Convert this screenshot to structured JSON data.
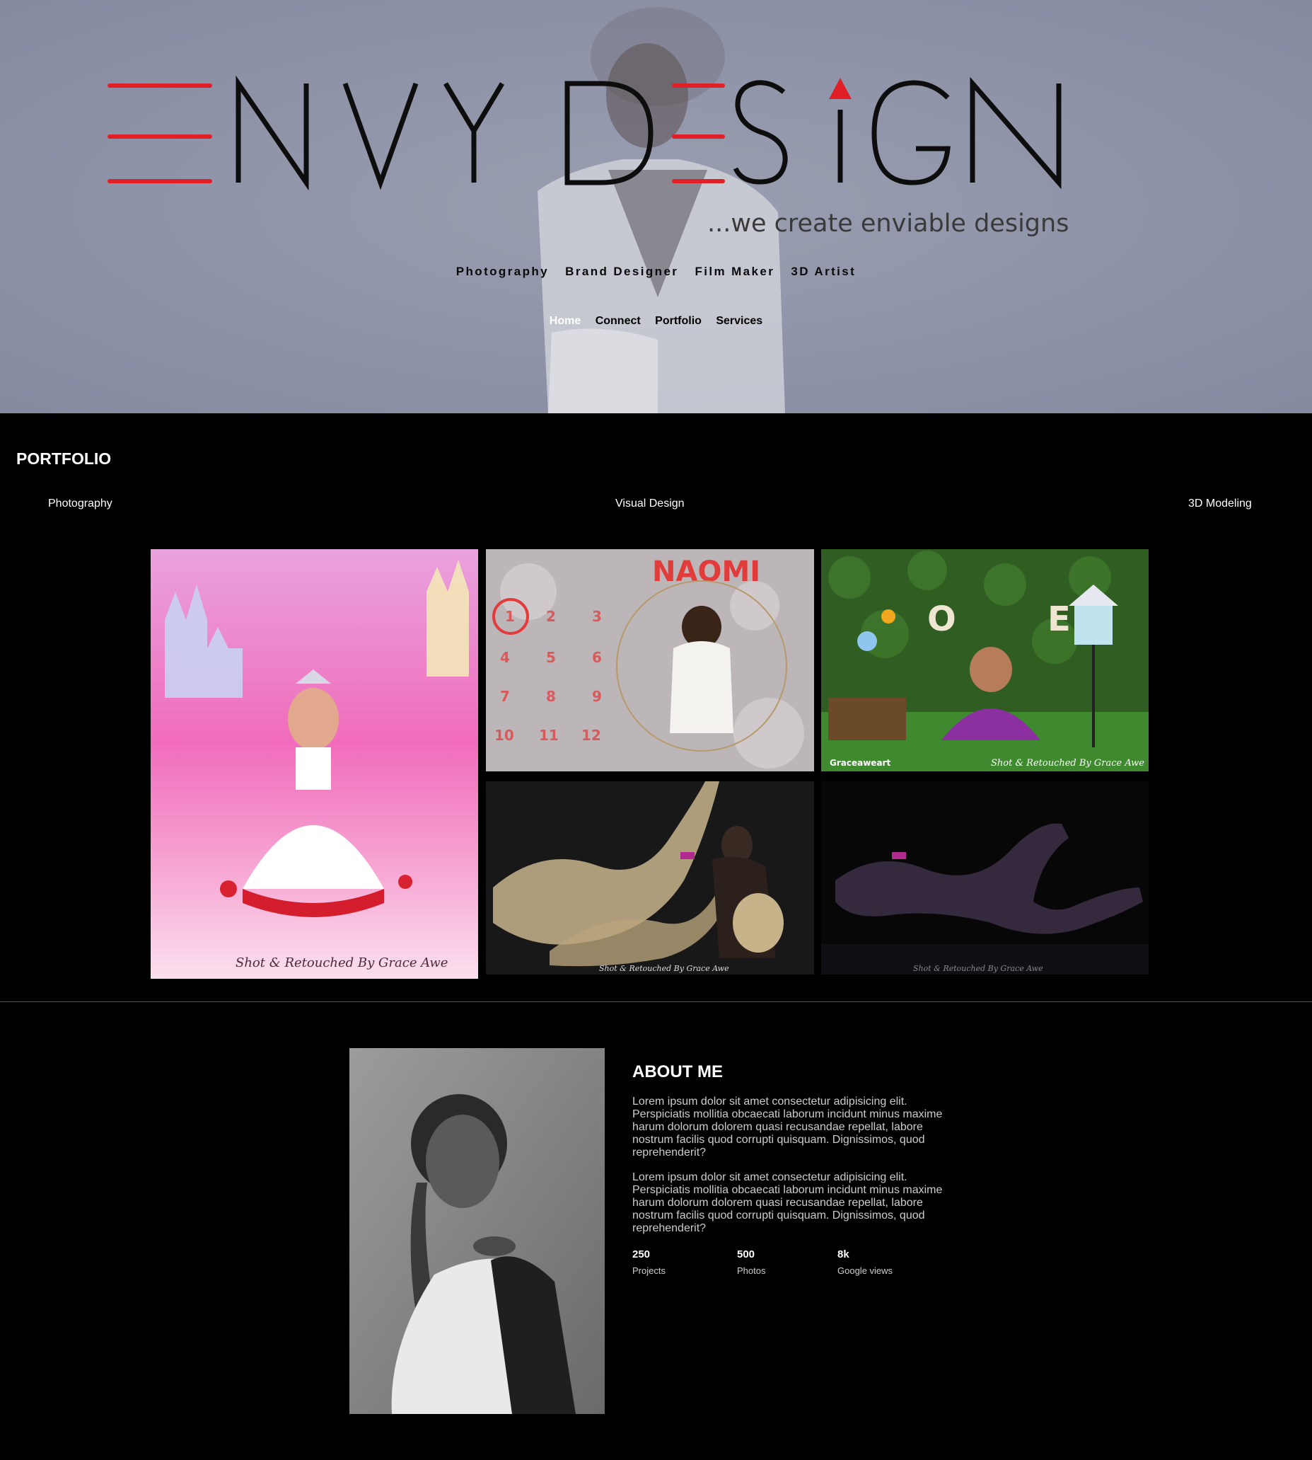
{
  "brand": {
    "logo_text": "ENVY DESIGN",
    "tagline": "...we create enviable designs",
    "accent_color": "#e01f26"
  },
  "roles": [
    "Photography",
    "Brand Designer",
    "Film Maker",
    "3D Artist"
  ],
  "nav": {
    "items": [
      {
        "label": "Home",
        "active": true
      },
      {
        "label": "Connect",
        "active": false
      },
      {
        "label": "Portfolio",
        "active": false
      },
      {
        "label": "Services",
        "active": false
      }
    ]
  },
  "portfolio": {
    "title": "PORTFOLIO",
    "filters": [
      "Photography",
      "Visual Design",
      "3D Modeling"
    ],
    "items": [
      {
        "name": "princess-castle-photo",
        "caption": "Shot & Retouched By Grace Awe"
      },
      {
        "name": "naomi-milestone-photo",
        "caption": "NAOMI"
      },
      {
        "name": "zoe-garden-photo",
        "caption": "Shot & Retouched By Grace Awe",
        "watermark": "Graceaweart"
      },
      {
        "name": "maternity-fabric-photo",
        "caption": "Shot & Retouched By Grace Awe"
      },
      {
        "name": "maternity-reclining-photo",
        "caption": "Shot & Retouched By Grace Awe"
      }
    ]
  },
  "about": {
    "title": "ABOUT ME",
    "paragraphs": [
      "Lorem ipsum dolor sit amet consectetur adipisicing elit. Perspiciatis mollitia obcaecati laborum incidunt minus maxime harum dolorum dolorem quasi recusandae repellat, labore nostrum facilis quod corrupti quisquam. Dignissimos, quod reprehenderit?",
      "Lorem ipsum dolor sit amet consectetur adipisicing elit. Perspiciatis mollitia obcaecati laborum incidunt minus maxime harum dolorum dolorem quasi recusandae repellat, labore nostrum facilis quod corrupti quisquam. Dignissimos, quod reprehenderit?"
    ],
    "stats": [
      {
        "value": "250",
        "label": "Projects"
      },
      {
        "value": "500",
        "label": "Photos"
      },
      {
        "value": "8k",
        "label": "Google views"
      }
    ]
  }
}
